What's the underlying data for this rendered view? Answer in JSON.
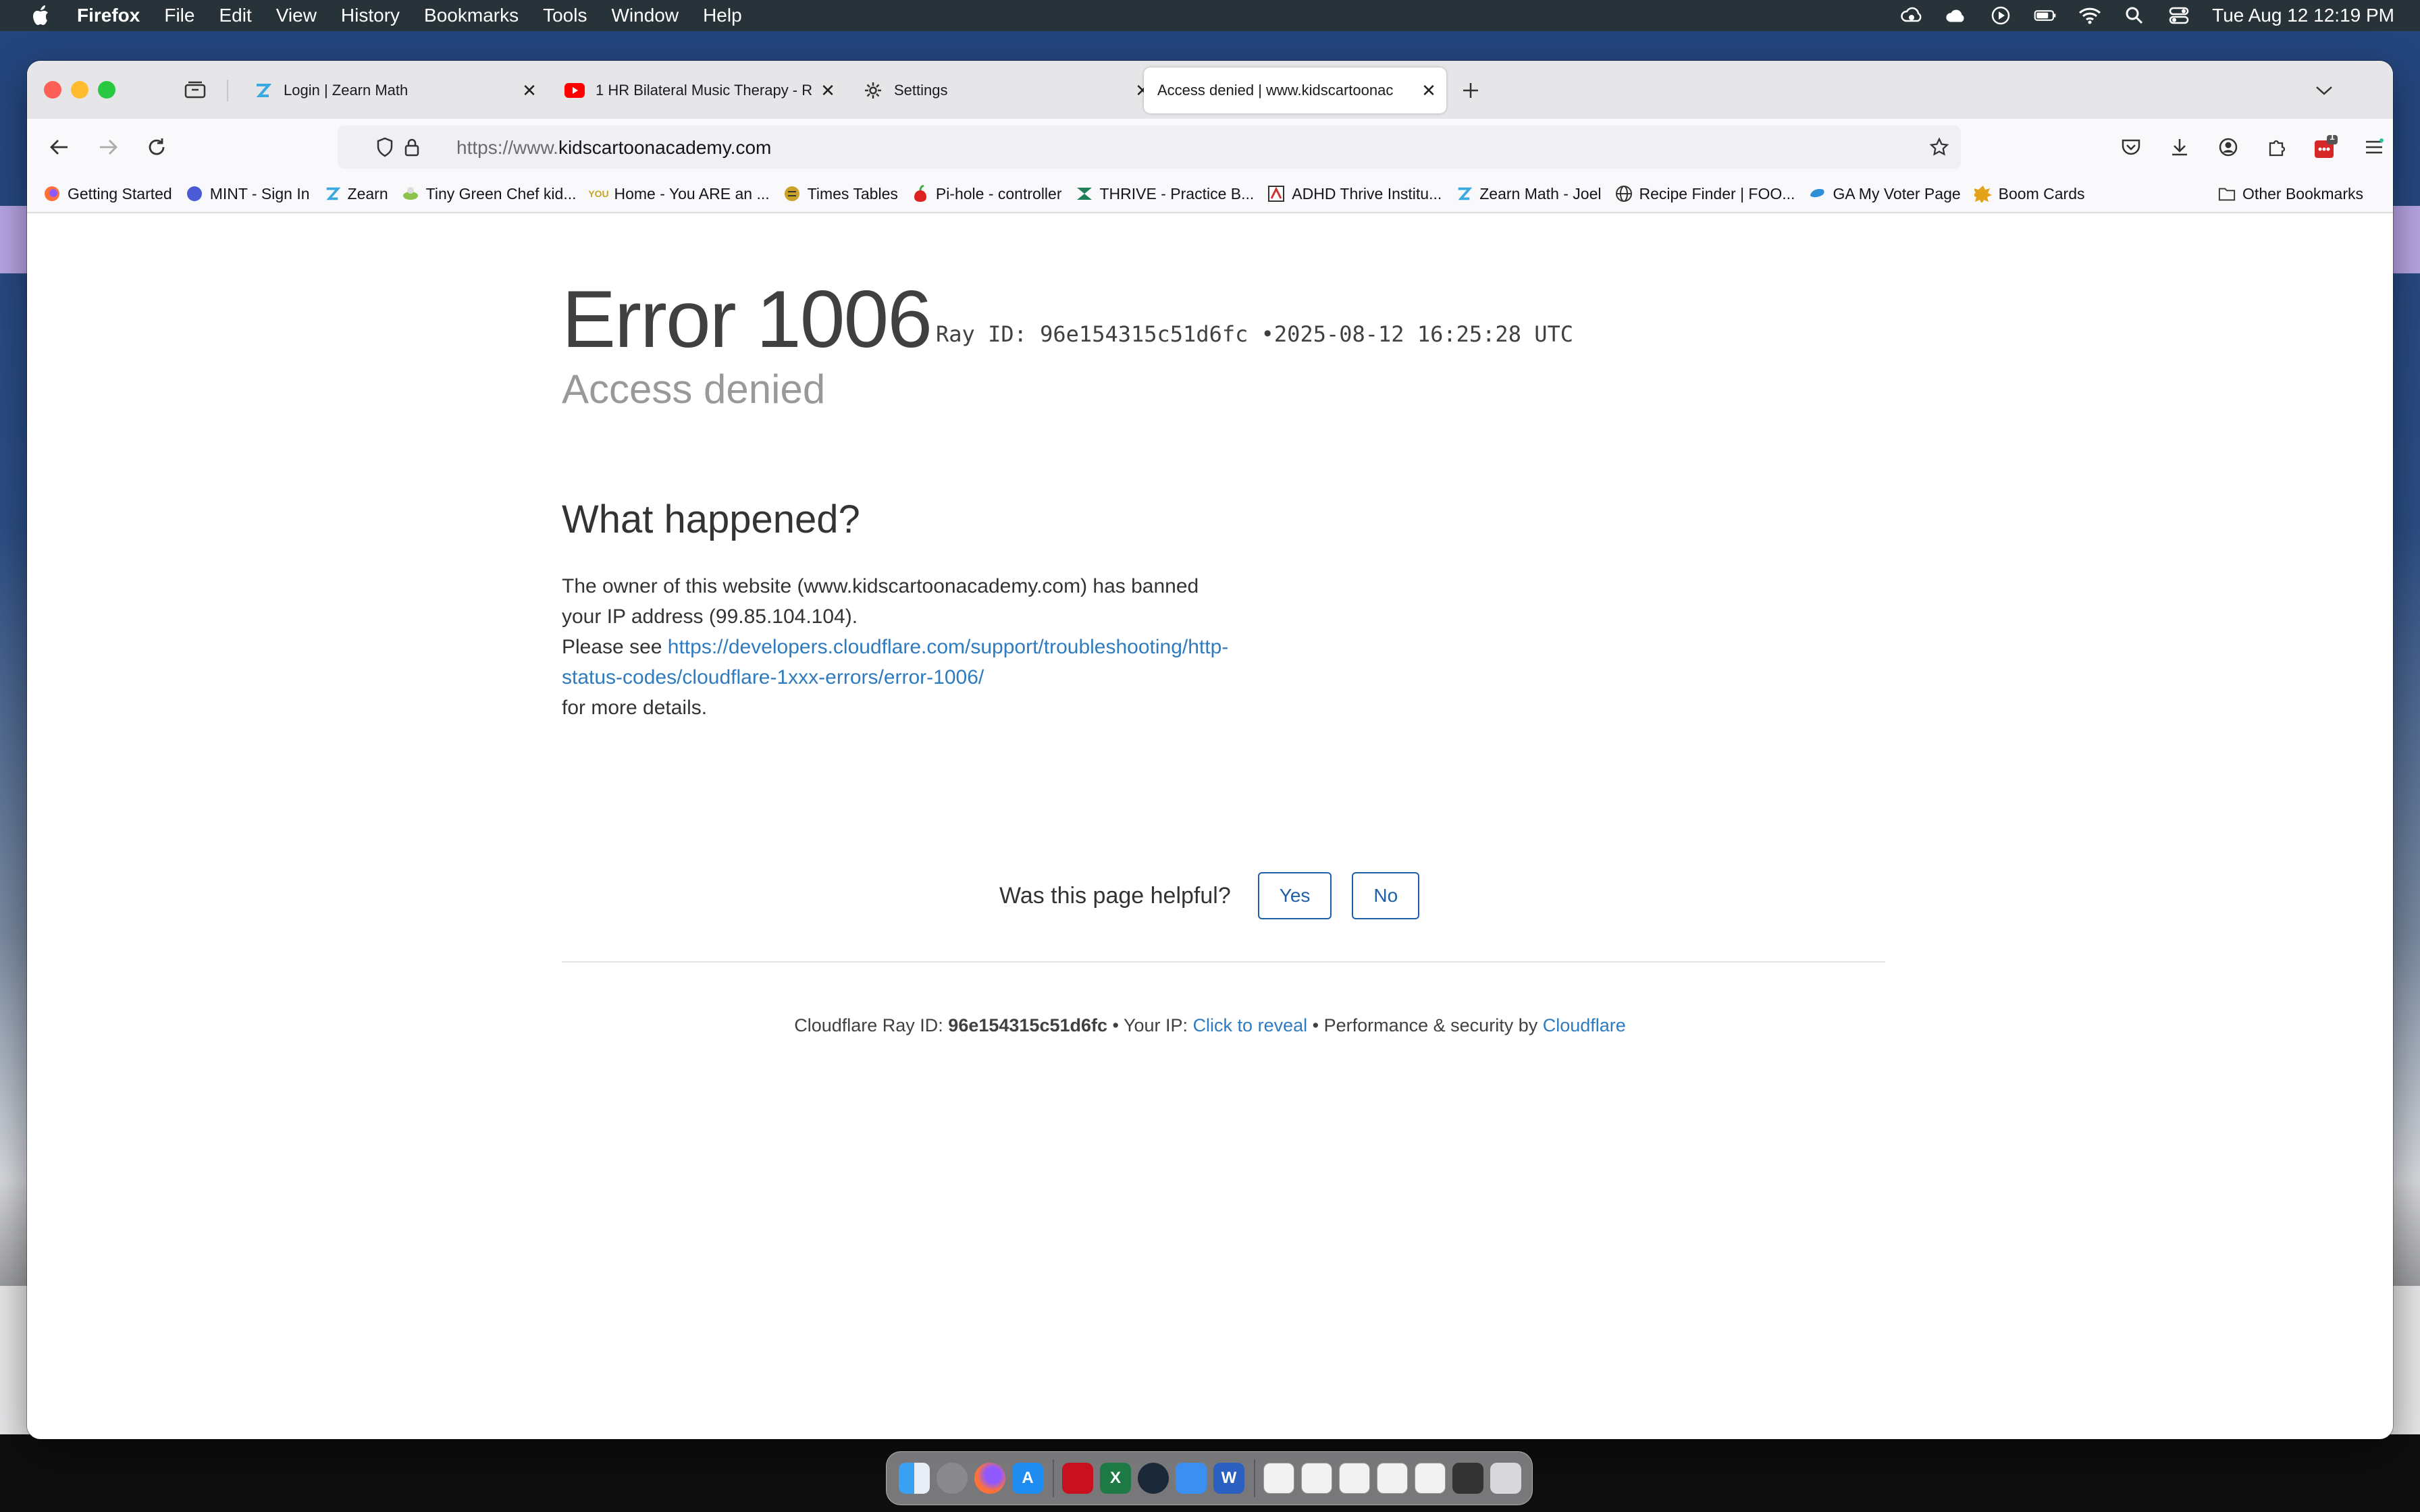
{
  "menubar": {
    "app_name": "Firefox",
    "items": [
      "File",
      "Edit",
      "View",
      "History",
      "Bookmarks",
      "Tools",
      "Window",
      "Help"
    ],
    "clock": "Tue Aug 12  12:19 PM"
  },
  "tabs": [
    {
      "label": "Login | Zearn Math",
      "icon": "zearn-icon"
    },
    {
      "label": "1 HR Bilateral Music Therapy - R",
      "icon": "youtube-icon"
    },
    {
      "label": "Settings",
      "icon": "gear-icon"
    },
    {
      "label": "Access denied | www.kidscartoonac",
      "icon": "none",
      "active": true
    }
  ],
  "url": {
    "prefix": "https://www.",
    "domain": "kidscartoonacademy.com"
  },
  "toolbar": {
    "extensions_badge": "1"
  },
  "bookmarks": [
    {
      "label": "Getting Started",
      "icon": "firefox-icon"
    },
    {
      "label": "MINT - Sign In",
      "icon": "mint-icon"
    },
    {
      "label": "Zearn",
      "icon": "zearn-icon"
    },
    {
      "label": "Tiny Green Chef kid...",
      "icon": "chef-icon"
    },
    {
      "label": "Home - You ARE an ...",
      "icon": "you-icon"
    },
    {
      "label": "Times Tables",
      "icon": "times-tables-icon"
    },
    {
      "label": "Pi-hole - controller",
      "icon": "pihole-icon"
    },
    {
      "label": "THRIVE - Practice B...",
      "icon": "thrive-icon"
    },
    {
      "label": "ADHD Thrive Institu...",
      "icon": "adhd-icon"
    },
    {
      "label": "Zearn Math - Joel",
      "icon": "zearn-icon"
    },
    {
      "label": "Recipe Finder | FOO...",
      "icon": "globe-icon"
    },
    {
      "label": "GA My Voter Page",
      "icon": "voter-icon"
    },
    {
      "label": "Boom Cards",
      "icon": "boom-icon"
    }
  ],
  "other_bookmarks": "Other Bookmarks",
  "page": {
    "error_title": "Error 1006",
    "ray_label": "Ray ID: 96e154315c51d6fc",
    "bullet": "•",
    "timestamp": "2025-08-12 16:25:28 UTC",
    "subtitle": "Access denied",
    "heading": "What happened?",
    "para_line1": "The owner of this website (www.kidscartoonacademy.com) has banned your IP address (99.85.104.104).",
    "para_please": "Please see ",
    "para_link": "https://developers.cloudflare.com/support/troubleshooting/http-status-codes/cloudflare-1xxx-errors/error-1006/",
    "para_end": "for more details.",
    "helpful_q": "Was this page helpful?",
    "yes": "Yes",
    "no": "No"
  },
  "footer": {
    "ray_prefix": "Cloudflare Ray ID: ",
    "ray_id": "96e154315c51d6fc",
    "sep": " • ",
    "ip_prefix": "Your IP: ",
    "ip_link": "Click to reveal",
    "perf_prefix": "Performance & security by ",
    "cf_link": "Cloudflare"
  },
  "colors": {
    "link": "#2f7bbf",
    "button_border": "#1f5fa8",
    "close_red": "#fe5f57",
    "minimize_yellow": "#febc2e",
    "zoom_green": "#28c840"
  }
}
